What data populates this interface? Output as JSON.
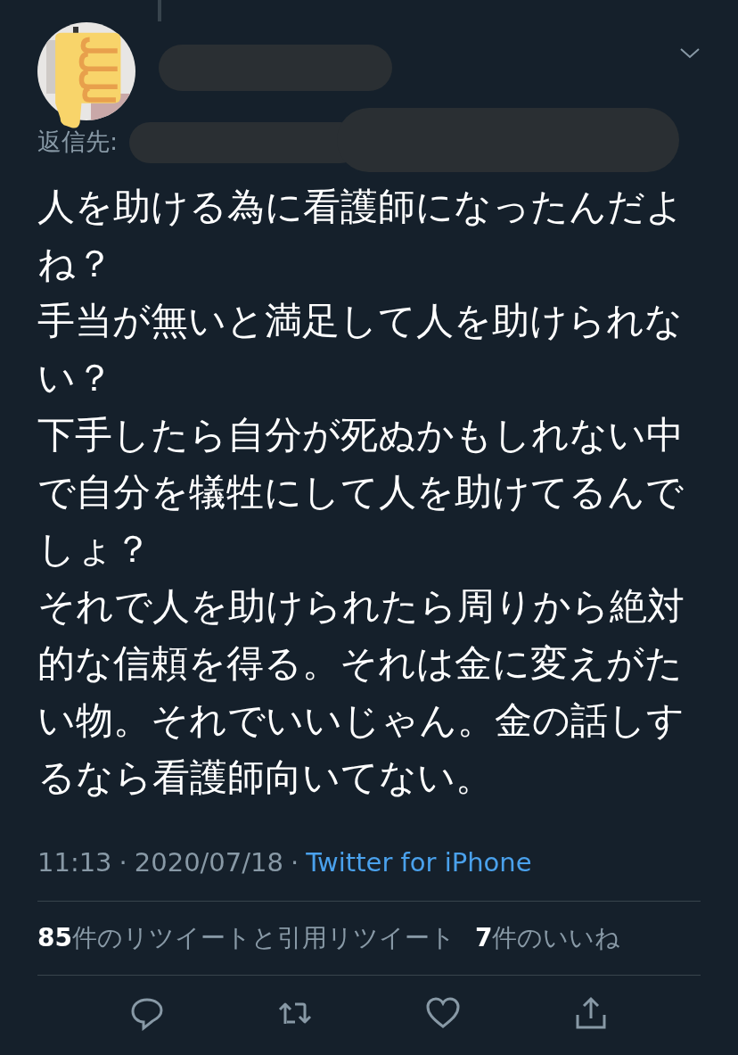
{
  "tweet": {
    "reply_to_label": "返信先:",
    "paragraphs": [
      "人を助ける為に看護師になったんだよね？",
      "手当が無いと満足して人を助けられない？",
      "下手したら自分が死ぬかもしれない中で自分を犠牲にして人を助けてるんでしょ？",
      "それで人を助けられたら周りから絶対的な信頼を得る。それは金に変えがたい物。それでいいじゃん。金の話しするなら看護師向いてない。"
    ],
    "time": "11:13",
    "date": "2020/07/18",
    "separator": "·",
    "source": "Twitter for iPhone",
    "stats": [
      {
        "count": "85",
        "label": "件のリツイートと引用リツイート"
      },
      {
        "count": "7",
        "label": "件のいいね"
      }
    ]
  }
}
